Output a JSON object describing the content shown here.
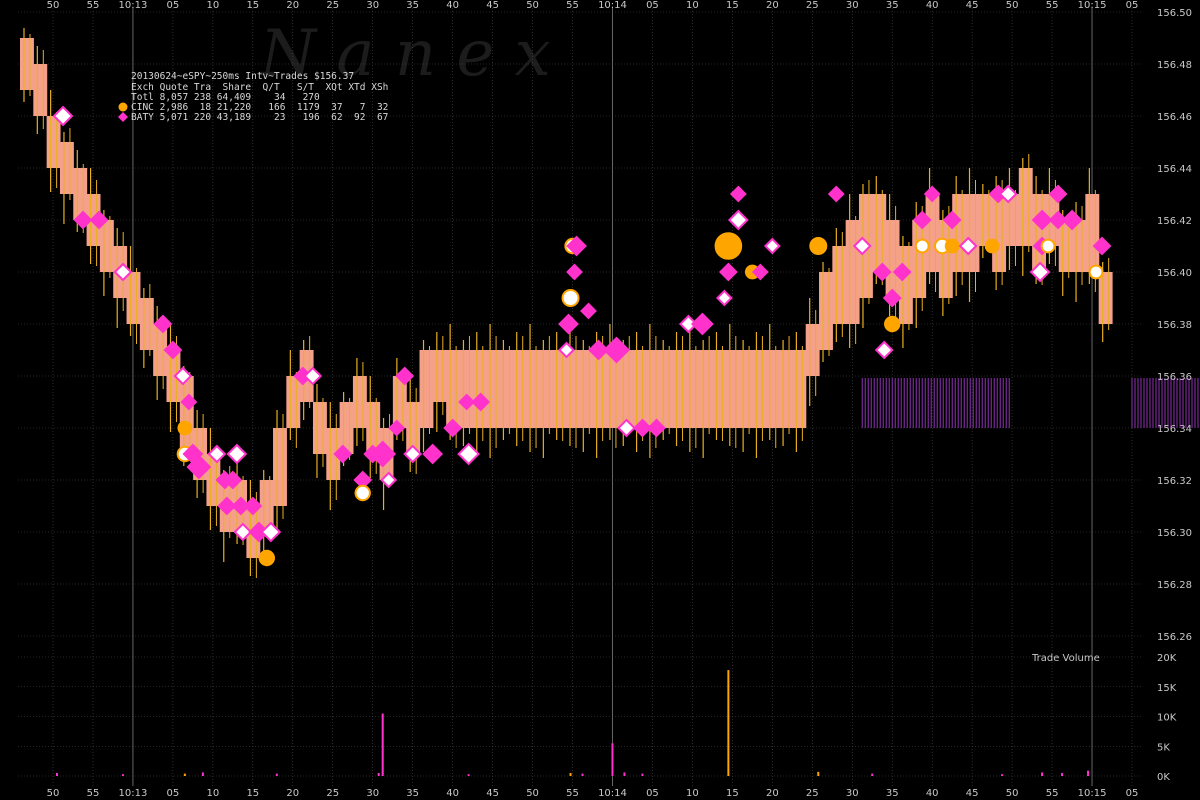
{
  "chart_data": [
    {
      "type": "scatter",
      "watermark": "N a n e x",
      "title": "20130624~eSPY~250ms Intv~Trades $156.37",
      "table": {
        "header": "Exch Quote Tra  Share  Q/T   S/T  XQt XTd XSh",
        "rows": [
          {
            "label": "Totl 8,057 238 64,409    34   270",
            "marker": "none"
          },
          {
            "label": "CINC 2,986  18 21,220   166  1179  37   7  32",
            "marker": "circle"
          },
          {
            "label": "BATY 5,071 220 43,189    23   196  62  92  67",
            "marker": "diamond"
          }
        ]
      },
      "series": [
        {
          "name": "CINC",
          "color": "#ffa500",
          "marker": "circle"
        },
        {
          "name": "BATY",
          "color": "#ff33cc",
          "marker": "diamond"
        }
      ],
      "colors": {
        "quote_band": "#f5a08a",
        "quote_line": "#e8b020",
        "baty_quote": "#7a2a9a",
        "grid": "#4a4a4a",
        "axis_text": "#c8c8c8"
      },
      "ylim": [
        156.25,
        156.51
      ],
      "y_ticks": [
        "156.26",
        "156.28",
        "156.30",
        "156.32",
        "156.34",
        "156.36",
        "156.38",
        "156.40",
        "156.42",
        "156.44",
        "156.46",
        "156.48",
        "156.50"
      ],
      "x_ticks": [
        "50",
        "55",
        "10:13",
        "05",
        "10",
        "15",
        "20",
        "25",
        "30",
        "35",
        "40",
        "45",
        "50",
        "55",
        "10:14",
        "05",
        "10",
        "15",
        "20",
        "25",
        "30",
        "35",
        "40",
        "45",
        "50",
        "55",
        "10:15",
        "05"
      ],
      "price_band": [
        [
          156.47,
          156.49
        ],
        [
          156.46,
          156.48
        ],
        [
          156.44,
          156.46
        ],
        [
          156.43,
          156.45
        ],
        [
          156.42,
          156.44
        ],
        [
          156.41,
          156.43
        ],
        [
          156.4,
          156.42
        ],
        [
          156.39,
          156.41
        ],
        [
          156.38,
          156.4
        ],
        [
          156.37,
          156.39
        ],
        [
          156.36,
          156.38
        ],
        [
          156.35,
          156.37
        ],
        [
          156.33,
          156.36
        ],
        [
          156.32,
          156.34
        ],
        [
          156.31,
          156.33
        ],
        [
          156.3,
          156.32
        ],
        [
          156.3,
          156.32
        ],
        [
          156.29,
          156.31
        ],
        [
          156.3,
          156.32
        ],
        [
          156.31,
          156.34
        ],
        [
          156.34,
          156.36
        ],
        [
          156.35,
          156.37
        ],
        [
          156.33,
          156.35
        ],
        [
          156.32,
          156.34
        ],
        [
          156.33,
          156.35
        ],
        [
          156.34,
          156.36
        ],
        [
          156.33,
          156.35
        ],
        [
          156.32,
          156.34
        ],
        [
          156.34,
          156.36
        ],
        [
          156.33,
          156.35
        ],
        [
          156.34,
          156.37
        ],
        [
          156.35,
          156.37
        ],
        [
          156.34,
          156.37
        ],
        [
          156.34,
          156.37
        ],
        [
          156.34,
          156.37
        ],
        [
          156.34,
          156.37
        ],
        [
          156.34,
          156.37
        ],
        [
          156.34,
          156.37
        ],
        [
          156.34,
          156.37
        ],
        [
          156.34,
          156.37
        ],
        [
          156.34,
          156.37
        ],
        [
          156.34,
          156.37
        ],
        [
          156.34,
          156.37
        ],
        [
          156.34,
          156.37
        ],
        [
          156.34,
          156.37
        ],
        [
          156.34,
          156.37
        ],
        [
          156.34,
          156.37
        ],
        [
          156.34,
          156.37
        ],
        [
          156.34,
          156.37
        ],
        [
          156.34,
          156.37
        ],
        [
          156.34,
          156.37
        ],
        [
          156.34,
          156.37
        ],
        [
          156.34,
          156.37
        ],
        [
          156.34,
          156.37
        ],
        [
          156.34,
          156.37
        ],
        [
          156.34,
          156.37
        ],
        [
          156.34,
          156.37
        ],
        [
          156.34,
          156.37
        ],
        [
          156.34,
          156.37
        ],
        [
          156.36,
          156.38
        ],
        [
          156.37,
          156.4
        ],
        [
          156.38,
          156.41
        ],
        [
          156.38,
          156.42
        ],
        [
          156.39,
          156.43
        ],
        [
          156.4,
          156.43
        ],
        [
          156.39,
          156.42
        ],
        [
          156.38,
          156.41
        ],
        [
          156.39,
          156.42
        ],
        [
          156.4,
          156.43
        ],
        [
          156.39,
          156.42
        ],
        [
          156.4,
          156.43
        ],
        [
          156.4,
          156.43
        ],
        [
          156.41,
          156.43
        ],
        [
          156.4,
          156.43
        ],
        [
          156.41,
          156.43
        ],
        [
          156.41,
          156.44
        ],
        [
          156.4,
          156.43
        ],
        [
          156.41,
          156.43
        ],
        [
          156.4,
          156.42
        ],
        [
          156.4,
          156.42
        ],
        [
          156.4,
          156.43
        ],
        [
          156.38,
          156.4
        ]
      ],
      "baty_quote_band": [
        {
          "from": 40.5,
          "to": 48,
          "low": 156.34,
          "high": 156.36
        },
        {
          "from": 54,
          "to": 59,
          "low": 156.34,
          "high": 156.36
        }
      ],
      "trades": [
        {
          "x": 0.5,
          "y": 156.46,
          "s": "BATY",
          "size": 9
        },
        {
          "x": 1.5,
          "y": 156.42,
          "s": "BATY",
          "size": 8
        },
        {
          "x": 2.3,
          "y": 156.42,
          "s": "BATY",
          "size": 8
        },
        {
          "x": 3.5,
          "y": 156.4,
          "s": "BATY",
          "size": 8
        },
        {
          "x": 5.5,
          "y": 156.38,
          "s": "BATY",
          "size": 8
        },
        {
          "x": 6.0,
          "y": 156.37,
          "s": "BATY",
          "size": 8
        },
        {
          "x": 6.5,
          "y": 156.36,
          "s": "BATY",
          "size": 8
        },
        {
          "x": 6.8,
          "y": 156.35,
          "s": "BATY",
          "size": 7
        },
        {
          "x": 6.6,
          "y": 156.34,
          "s": "CINC",
          "size": 8
        },
        {
          "x": 6.6,
          "y": 156.33,
          "s": "CINC",
          "size": 9
        },
        {
          "x": 7.0,
          "y": 156.33,
          "s": "BATY",
          "size": 9
        },
        {
          "x": 7.3,
          "y": 156.325,
          "s": "BATY",
          "size": 11
        },
        {
          "x": 8.2,
          "y": 156.33,
          "s": "BATY",
          "size": 8
        },
        {
          "x": 8.6,
          "y": 156.32,
          "s": "BATY",
          "size": 8
        },
        {
          "x": 9.0,
          "y": 156.32,
          "s": "BATY",
          "size": 8
        },
        {
          "x": 9.2,
          "y": 156.33,
          "s": "BATY",
          "size": 9
        },
        {
          "x": 8.7,
          "y": 156.31,
          "s": "BATY",
          "size": 8
        },
        {
          "x": 9.4,
          "y": 156.31,
          "s": "BATY",
          "size": 8
        },
        {
          "x": 9.5,
          "y": 156.3,
          "s": "BATY",
          "size": 8
        },
        {
          "x": 10.0,
          "y": 156.31,
          "s": "BATY",
          "size": 8
        },
        {
          "x": 10.3,
          "y": 156.3,
          "s": "BATY",
          "size": 9
        },
        {
          "x": 10.9,
          "y": 156.3,
          "s": "BATY",
          "size": 9
        },
        {
          "x": 10.7,
          "y": 156.29,
          "s": "CINC",
          "size": 9
        },
        {
          "x": 12.5,
          "y": 156.36,
          "s": "BATY",
          "size": 8
        },
        {
          "x": 13.0,
          "y": 156.36,
          "s": "BATY",
          "size": 8
        },
        {
          "x": 14.5,
          "y": 156.33,
          "s": "BATY",
          "size": 8
        },
        {
          "x": 15.5,
          "y": 156.32,
          "s": "BATY",
          "size": 8
        },
        {
          "x": 15.5,
          "y": 156.315,
          "s": "CINC",
          "size": 9
        },
        {
          "x": 16.0,
          "y": 156.33,
          "s": "BATY",
          "size": 8
        },
        {
          "x": 16.5,
          "y": 156.33,
          "s": "BATY",
          "size": 12
        },
        {
          "x": 16.8,
          "y": 156.32,
          "s": "BATY",
          "size": 7
        },
        {
          "x": 17.2,
          "y": 156.34,
          "s": "BATY",
          "size": 7
        },
        {
          "x": 17.6,
          "y": 156.36,
          "s": "BATY",
          "size": 8
        },
        {
          "x": 18.0,
          "y": 156.33,
          "s": "BATY",
          "size": 8
        },
        {
          "x": 19.0,
          "y": 156.33,
          "s": "BATY",
          "size": 9
        },
        {
          "x": 20.0,
          "y": 156.34,
          "s": "BATY",
          "size": 8
        },
        {
          "x": 20.8,
          "y": 156.33,
          "s": "BATY",
          "size": 10
        },
        {
          "x": 20.7,
          "y": 156.35,
          "s": "BATY",
          "size": 7
        },
        {
          "x": 21.4,
          "y": 156.35,
          "s": "BATY",
          "size": 8
        },
        {
          "x": 26.0,
          "y": 156.41,
          "s": "CINC",
          "size": 9
        },
        {
          "x": 26.2,
          "y": 156.41,
          "s": "BATY",
          "size": 9
        },
        {
          "x": 26.1,
          "y": 156.4,
          "s": "BATY",
          "size": 7
        },
        {
          "x": 25.9,
          "y": 156.39,
          "s": "CINC",
          "size": 10
        },
        {
          "x": 26.8,
          "y": 156.385,
          "s": "BATY",
          "size": 7
        },
        {
          "x": 25.8,
          "y": 156.38,
          "s": "BATY",
          "size": 9
        },
        {
          "x": 25.7,
          "y": 156.37,
          "s": "BATY",
          "size": 7
        },
        {
          "x": 27.3,
          "y": 156.37,
          "s": "BATY",
          "size": 9
        },
        {
          "x": 28.2,
          "y": 156.37,
          "s": "BATY",
          "size": 12
        },
        {
          "x": 28.7,
          "y": 156.34,
          "s": "BATY",
          "size": 8
        },
        {
          "x": 29.5,
          "y": 156.34,
          "s": "BATY",
          "size": 8
        },
        {
          "x": 30.2,
          "y": 156.34,
          "s": "BATY",
          "size": 8
        },
        {
          "x": 31.8,
          "y": 156.38,
          "s": "BATY",
          "size": 8
        },
        {
          "x": 32.5,
          "y": 156.38,
          "s": "BATY",
          "size": 10
        },
        {
          "x": 33.8,
          "y": 156.41,
          "s": "CINC",
          "size": 16
        },
        {
          "x": 34.3,
          "y": 156.42,
          "s": "BATY",
          "size": 9
        },
        {
          "x": 34.3,
          "y": 156.43,
          "s": "BATY",
          "size": 7
        },
        {
          "x": 33.8,
          "y": 156.4,
          "s": "BATY",
          "size": 8
        },
        {
          "x": 33.6,
          "y": 156.39,
          "s": "BATY",
          "size": 7
        },
        {
          "x": 35.0,
          "y": 156.4,
          "s": "CINC",
          "size": 8
        },
        {
          "x": 35.4,
          "y": 156.4,
          "s": "BATY",
          "size": 7
        },
        {
          "x": 36.0,
          "y": 156.41,
          "s": "BATY",
          "size": 7
        },
        {
          "x": 38.3,
          "y": 156.41,
          "s": "CINC",
          "size": 10
        },
        {
          "x": 39.2,
          "y": 156.43,
          "s": "BATY",
          "size": 7
        },
        {
          "x": 40.5,
          "y": 156.41,
          "s": "BATY",
          "size": 8
        },
        {
          "x": 41.5,
          "y": 156.4,
          "s": "BATY",
          "size": 8
        },
        {
          "x": 42.0,
          "y": 156.39,
          "s": "BATY",
          "size": 8
        },
        {
          "x": 41.6,
          "y": 156.37,
          "s": "BATY",
          "size": 8
        },
        {
          "x": 42.0,
          "y": 156.38,
          "s": "CINC",
          "size": 9
        },
        {
          "x": 42.5,
          "y": 156.4,
          "s": "BATY",
          "size": 8
        },
        {
          "x": 43.5,
          "y": 156.41,
          "s": "CINC",
          "size": 8
        },
        {
          "x": 43.5,
          "y": 156.42,
          "s": "BATY",
          "size": 8
        },
        {
          "x": 44.0,
          "y": 156.43,
          "s": "BATY",
          "size": 7
        },
        {
          "x": 44.5,
          "y": 156.41,
          "s": "CINC",
          "size": 9
        },
        {
          "x": 45.0,
          "y": 156.42,
          "s": "BATY",
          "size": 8
        },
        {
          "x": 45.0,
          "y": 156.41,
          "s": "CINC",
          "size": 8
        },
        {
          "x": 45.8,
          "y": 156.41,
          "s": "BATY",
          "size": 8
        },
        {
          "x": 47.0,
          "y": 156.41,
          "s": "CINC",
          "size": 8
        },
        {
          "x": 47.3,
          "y": 156.43,
          "s": "BATY",
          "size": 8
        },
        {
          "x": 47.8,
          "y": 156.43,
          "s": "BATY",
          "size": 8
        },
        {
          "x": 49.5,
          "y": 156.42,
          "s": "BATY",
          "size": 9
        },
        {
          "x": 49.5,
          "y": 156.41,
          "s": "BATY",
          "size": 8
        },
        {
          "x": 49.8,
          "y": 156.41,
          "s": "CINC",
          "size": 8
        },
        {
          "x": 50.3,
          "y": 156.43,
          "s": "BATY",
          "size": 8
        },
        {
          "x": 50.3,
          "y": 156.42,
          "s": "BATY",
          "size": 8
        },
        {
          "x": 49.4,
          "y": 156.4,
          "s": "BATY",
          "size": 9
        },
        {
          "x": 51.0,
          "y": 156.42,
          "s": "CINC",
          "size": 8
        },
        {
          "x": 51.0,
          "y": 156.42,
          "s": "BATY",
          "size": 9
        },
        {
          "x": 52.2,
          "y": 156.4,
          "s": "CINC",
          "size": 8
        },
        {
          "x": 52.5,
          "y": 156.41,
          "s": "BATY",
          "size": 8
        }
      ],
      "volume": {
        "label": "Trade Volume",
        "ylim": [
          0,
          20000
        ],
        "y_ticks": [
          "0K",
          "5K",
          "10K",
          "15K",
          "20K"
        ],
        "bars": [
          {
            "x": 0.2,
            "v": 500,
            "s": "BATY"
          },
          {
            "x": 3.5,
            "v": 300,
            "s": "BATY"
          },
          {
            "x": 6.6,
            "v": 400,
            "s": "CINC"
          },
          {
            "x": 7.5,
            "v": 600,
            "s": "BATY"
          },
          {
            "x": 11.2,
            "v": 400,
            "s": "BATY"
          },
          {
            "x": 16.5,
            "v": 10500,
            "s": "BATY"
          },
          {
            "x": 16.3,
            "v": 500,
            "s": "BATY"
          },
          {
            "x": 20.8,
            "v": 300,
            "s": "BATY"
          },
          {
            "x": 25.9,
            "v": 500,
            "s": "CINC"
          },
          {
            "x": 26.5,
            "v": 400,
            "s": "BATY"
          },
          {
            "x": 28.0,
            "v": 5500,
            "s": "BATY"
          },
          {
            "x": 28.6,
            "v": 600,
            "s": "BATY"
          },
          {
            "x": 29.5,
            "v": 400,
            "s": "BATY"
          },
          {
            "x": 33.8,
            "v": 17800,
            "s": "CINC"
          },
          {
            "x": 38.3,
            "v": 700,
            "s": "CINC"
          },
          {
            "x": 41.0,
            "v": 400,
            "s": "BATY"
          },
          {
            "x": 47.5,
            "v": 300,
            "s": "BATY"
          },
          {
            "x": 49.5,
            "v": 600,
            "s": "BATY"
          },
          {
            "x": 50.5,
            "v": 500,
            "s": "BATY"
          },
          {
            "x": 51.8,
            "v": 900,
            "s": "BATY"
          }
        ]
      }
    }
  ]
}
